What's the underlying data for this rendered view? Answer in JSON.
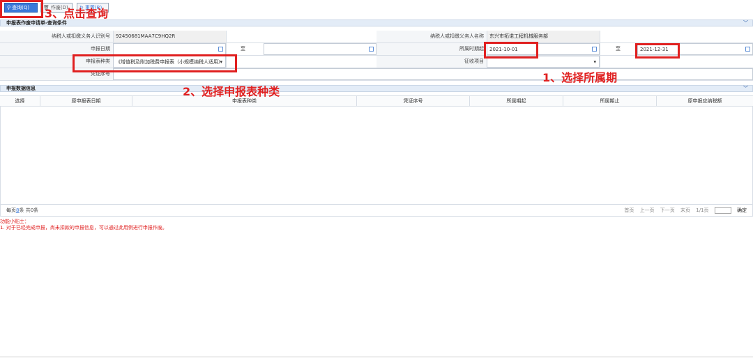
{
  "toolbar": {
    "query_label": "查询(Q)",
    "void_label": "作废(D)",
    "reset_label": "重置(R)"
  },
  "query_section": {
    "title": "申报表作废申请单-查询条件",
    "taxpayer_id_label": "纳税人或扣缴义务人识别号",
    "taxpayer_id_value": "92450681MAA7C9HQ2R",
    "taxpayer_name_label": "纳税人或扣缴义务人名称",
    "taxpayer_name_value": "东兴市拓诺工程机械服务部",
    "declare_date_label": "申报日期",
    "to_label": "至",
    "period_start_label": "所属时期起",
    "period_start_value": "2021-10-01",
    "period_end_value": "2021-12-31",
    "form_type_label": "申报表种类",
    "form_type_value": "《增值税及附加税费申报表（小规模纳税人适用）",
    "tax_item_label": "征收项目",
    "voucher_label": "凭证序号"
  },
  "data_section": {
    "title": "申报数据信息",
    "columns": [
      "选择",
      "原申报表日期",
      "申报表种类",
      "凭证序号",
      "所属期起",
      "所属期止",
      "原申报应纳税额"
    ]
  },
  "pager": {
    "per_page_prefix": "每页",
    "per_page_num": "8",
    "per_page_suffix": "条 共0条",
    "first": "首页",
    "prev": "上一页",
    "next": "下一页",
    "last": "末页",
    "page_info": "1/1页",
    "ok": "确定"
  },
  "tips": {
    "title": "功能小贴士：",
    "line1": "1. 对于已经完成申报，尚未扣款的申报信息，可以通过此用例进行申报作废。"
  },
  "annotations": {
    "step1": "1、选择所属期",
    "step2": "2、选择申报表种类",
    "step3": "3、点击查询"
  },
  "colors": {
    "accent": "#3a78d8",
    "annotation": "#e02020"
  }
}
